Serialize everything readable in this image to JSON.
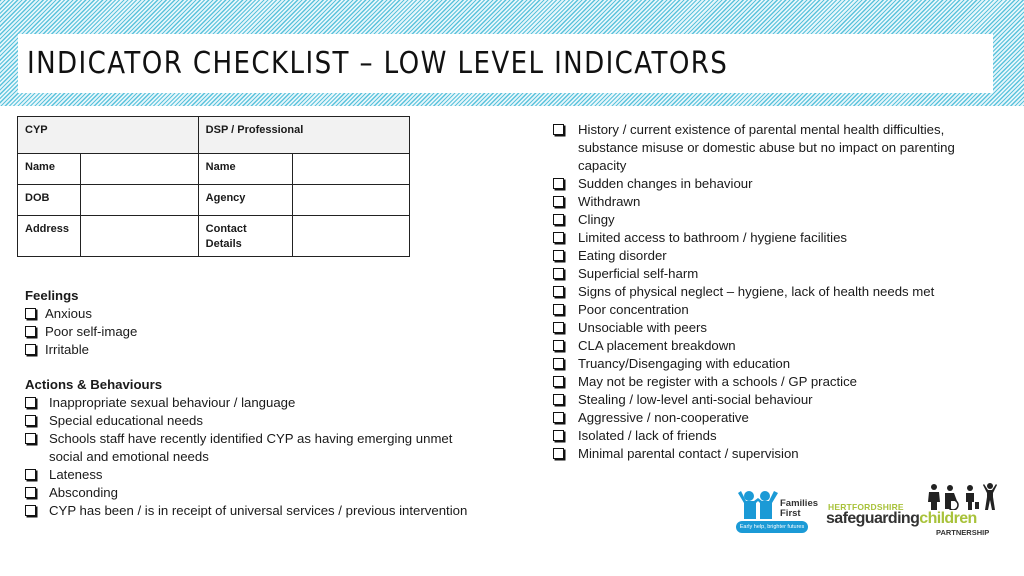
{
  "title": "INDICATOR CHECKLIST – LOW LEVEL INDICATORS",
  "info_table": {
    "header": {
      "cyp": "CYP",
      "dsp": "DSP / Professional"
    },
    "rows": [
      {
        "left_label": "Name",
        "left_value": "",
        "right_label": "Name",
        "right_value": ""
      },
      {
        "left_label": "DOB",
        "left_value": "",
        "right_label": "Agency",
        "right_value": ""
      },
      {
        "left_label": "Address",
        "left_value": "",
        "right_label": "Contact Details",
        "right_value": ""
      }
    ]
  },
  "feelings": {
    "heading": "Feelings",
    "items": [
      "Anxious",
      "Poor self-image",
      "Irritable"
    ]
  },
  "actions": {
    "heading": "Actions & Behaviours",
    "items": [
      "Inappropriate sexual behaviour / language",
      "Special educational needs",
      "Schools staff have recently identified CYP as having emerging unmet social and emotional needs",
      "Lateness",
      "Absconding",
      "CYP has been / is in receipt of universal services / previous intervention"
    ]
  },
  "right_items": [
    "History / current existence of parental mental health difficulties, substance misuse or domestic abuse but no impact on parenting capacity",
    "Sudden changes in behaviour",
    "Withdrawn",
    "Clingy",
    "Limited access to bathroom / hygiene facilities",
    "Eating disorder",
    "Superficial self-harm",
    "Signs of physical neglect – hygiene, lack of health needs met",
    "Poor concentration",
    "Unsociable with peers",
    "CLA placement breakdown",
    "Truancy/Disengaging with education",
    "May not be register with a schools / GP practice",
    "Stealing / low-level anti-social behaviour",
    "Aggressive / non-cooperative",
    "Isolated / lack of friends",
    "Minimal parental contact / supervision"
  ],
  "logos": {
    "families_first": {
      "line1": "Families",
      "line2": "First",
      "tagline": "Early help, brighter futures",
      "color": "#1b9ad6"
    },
    "hscp": {
      "top": "HERTFORDSHIRE",
      "main_a": "safeguarding",
      "main_b": "children",
      "bottom": "PARTNERSHIP",
      "accent": "#a8c23a"
    }
  },
  "colors": {
    "hatch": "#5cc3dc",
    "table_header_bg": "#f2f2f2"
  }
}
